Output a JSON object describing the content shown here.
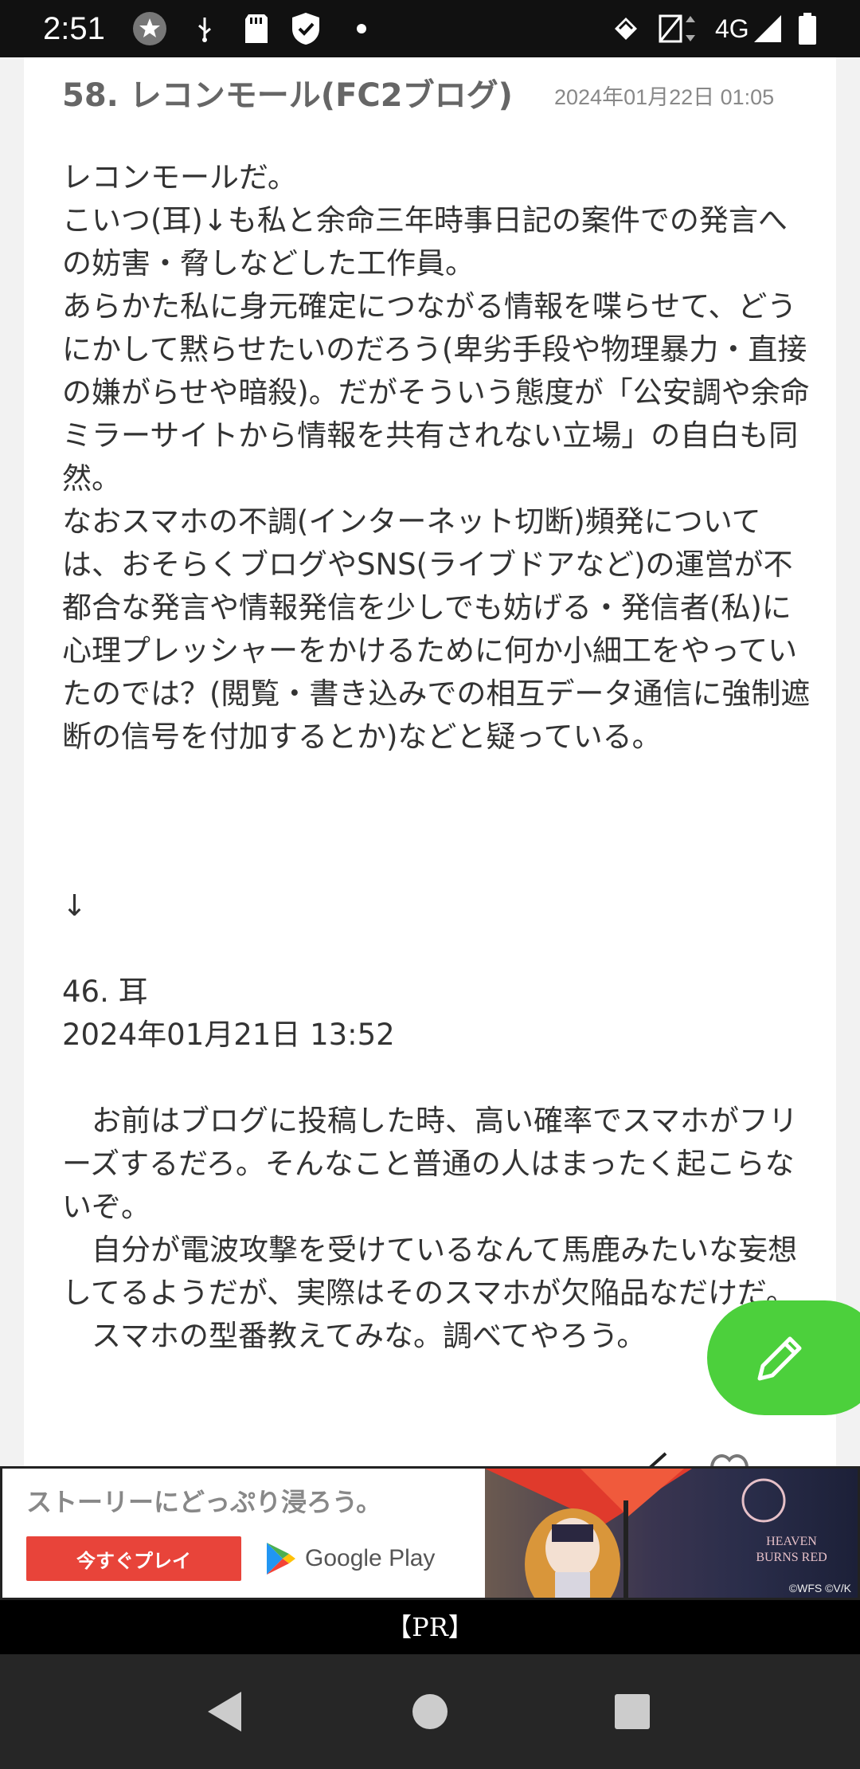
{
  "status_bar": {
    "time": "2:51",
    "network": "4G",
    "icons": [
      "star-notification-icon",
      "usb-icon",
      "sd-card-icon",
      "shield-check-icon",
      "dot-icon",
      "data-saver-icon",
      "no-sim-icon",
      "signal-icon",
      "battery-icon"
    ]
  },
  "post": {
    "title": "58.  レコンモール(FC2ブログ)",
    "date": "2024年01月22日 01:05",
    "body": "レコンモールだ。\nこいつ(耳)↓も私と余命三年時事日記の案件での発言への妨害・脅しなどした工作員。\nあらかた私に身元確定につながる情報を喋らせて、どうにかして黙らせたいのだろう(卑劣手段や物理暴力・直接の嫌がらせや暗殺)。だがそういう態度が「公安調や余命ミラーサイトから情報を共有されない立場」の自白も同然。\nなおスマホの不調(インターネット切断)頻発については、おそらくブログやSNS(ライブドアなど)の運営が不都合な発言や情報発信を少しでも妨げる・発信者(私)に心理プレッシャーをかけるために何か小細工をやっていたのでは？(閲覧・書き込みでの相互データ通信に強制遮断の信号を付加するとか)などと疑っている。",
    "arrow": "↓",
    "quoted_header": "46. 耳\n2024年01月21日 13:52",
    "quoted_body": "　お前はブログに投稿した時、高い確率でスマホがフリーズするだろ。そんなこと普通の人はまったく起こらないぞ。\n　自分が電波攻撃を受けているなんて馬鹿みたいな妄想してるようだが、実際はそのスマホが欠陥品なだけだ。\n　スマホの型番教えてみな。調べてやろう。"
  },
  "fab": {
    "icon": "pencil-icon"
  },
  "ad": {
    "headline": "ストーリーにどっぷり浸ろう。",
    "cta": "今すぐプレイ",
    "store": "Google Play",
    "game_logo": "HEAVEN BURNS RED",
    "copyright": "©WFS ©V/K"
  },
  "pr_label": "【PR】",
  "nav": {
    "back": "back-icon",
    "home": "home-icon",
    "recents": "recents-icon"
  },
  "colors": {
    "fab": "#4cd03c",
    "cta": "#e8443a",
    "status_bar": "#111111",
    "nav_bar": "#262626"
  }
}
